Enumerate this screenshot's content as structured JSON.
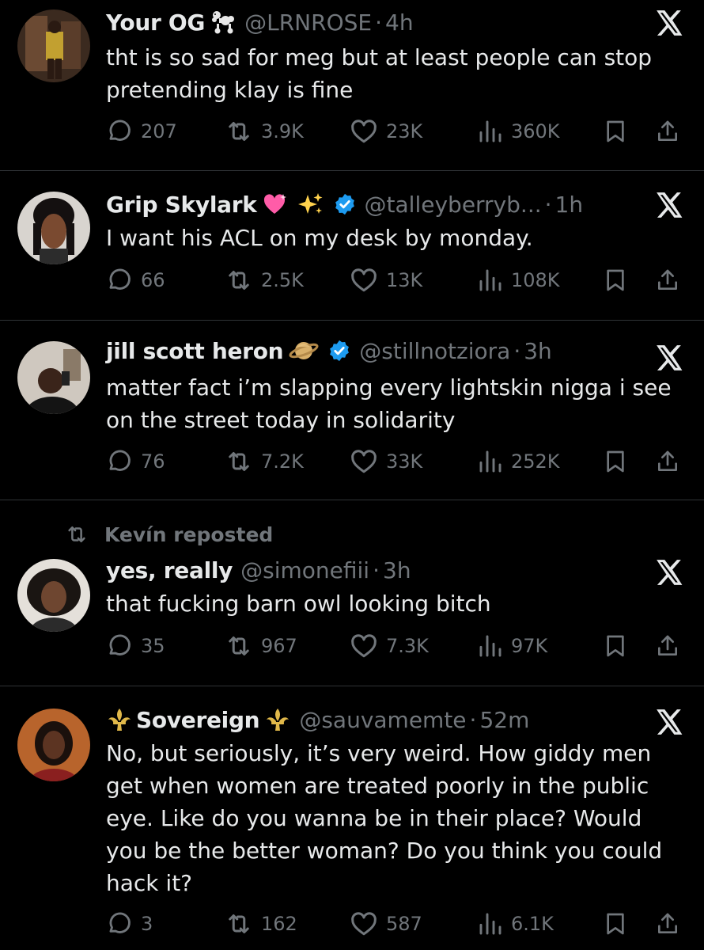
{
  "colors": {
    "background": "#000000",
    "text": "#e7e9ea",
    "muted": "#71767b",
    "verified": "#1d9bf0",
    "separator": "#2f3336"
  },
  "tweets": [
    {
      "name": "Your OG",
      "name_emoji": "poodle",
      "verified": false,
      "handle": "@LRNROSE",
      "time": "4h",
      "text": "tht is so sad for meg but at least people can stop pretending klay is fine",
      "replies": "207",
      "reposts": "3.9K",
      "likes": "23K",
      "views": "360K"
    },
    {
      "name": "Grip Skylark",
      "name_emoji": "sparkling-heart sparkles",
      "verified": true,
      "handle": "@talleyberryb...",
      "time": "1h",
      "text": "I want his ACL on my desk by monday.",
      "replies": "66",
      "reposts": "2.5K",
      "likes": "13K",
      "views": "108K"
    },
    {
      "name": "jill scott heron",
      "name_emoji": "ringed-planet",
      "verified": true,
      "handle": "@stillnotziora",
      "time": "3h",
      "text": "matter fact i’m slapping every lightskin nigga i see on the street today in solidarity",
      "replies": "76",
      "reposts": "7.2K",
      "likes": "33K",
      "views": "252K"
    },
    {
      "repost_context": "Kevín reposted",
      "name": "yes, really",
      "verified": false,
      "handle": "@simonefiii",
      "time": "3h",
      "text": "that fucking barn owl looking bitch",
      "replies": "35",
      "reposts": "967",
      "likes": "7.3K",
      "views": "97K"
    },
    {
      "name": "Sovereign",
      "name_emoji": "fleur-de-lis",
      "verified": false,
      "handle": "@sauvamemte",
      "time": "52m",
      "text": "No, but seriously, it’s very weird. How giddy men get when women are treated poorly in the public eye. Like do you wanna be in their place? Would you be the better woman? Do you think you could hack it?",
      "replies": "3",
      "reposts": "162",
      "likes": "587",
      "views": "6.1K"
    }
  ]
}
